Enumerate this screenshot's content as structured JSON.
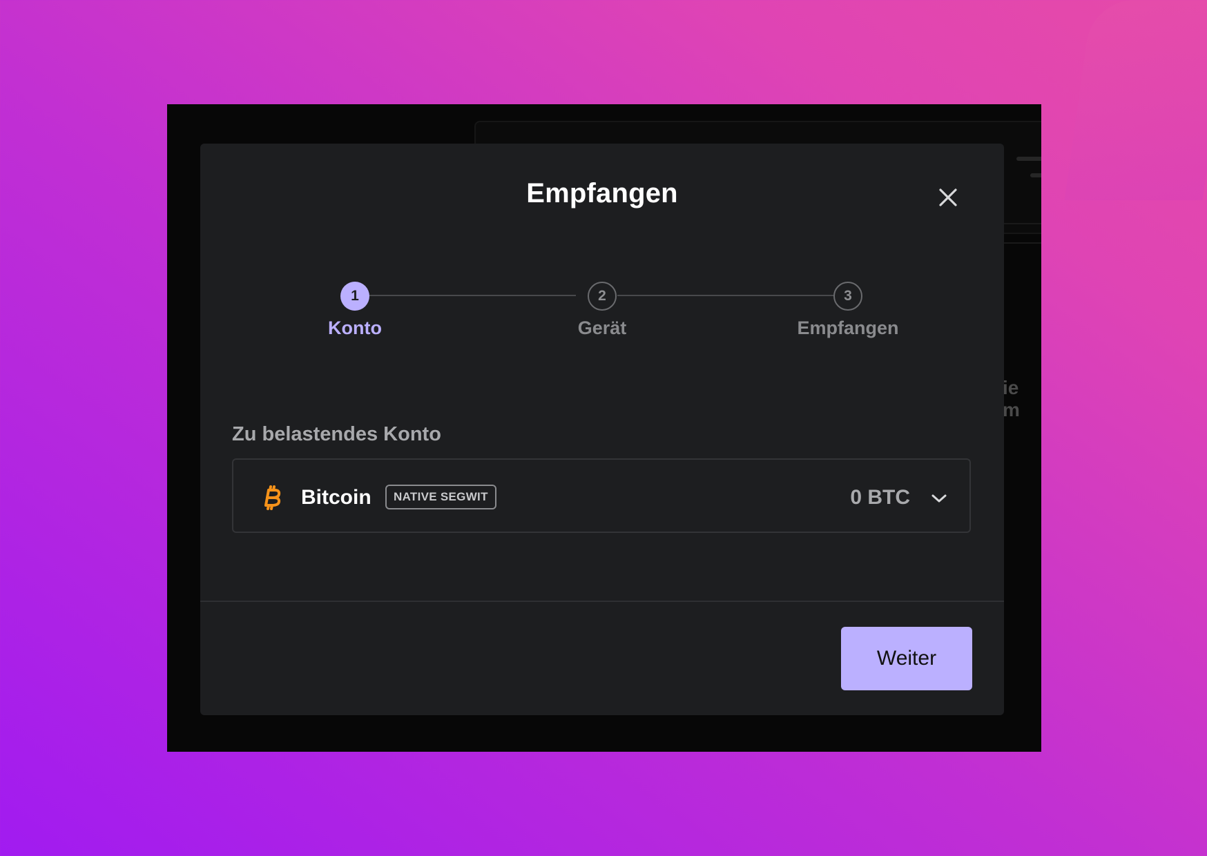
{
  "modal": {
    "title": "Empfangen"
  },
  "stepper": {
    "steps": [
      {
        "number": "1",
        "label": "Konto",
        "state": "active"
      },
      {
        "number": "2",
        "label": "Gerät",
        "state": "inactive"
      },
      {
        "number": "3",
        "label": "Empfangen",
        "state": "inactive"
      }
    ]
  },
  "account": {
    "label": "Zu belastendes Konto",
    "name": "Bitcoin",
    "tag": "NATIVE SEGWIT",
    "balance": "0 BTC",
    "icon": "bitcoin-icon"
  },
  "footer": {
    "next_label": "Weiter"
  },
  "background": {
    "partial_text": "ie m"
  },
  "colors": {
    "accent": "#bbb0ff",
    "modal_bg": "#1d1e20",
    "bitcoin": "#f7931a"
  }
}
